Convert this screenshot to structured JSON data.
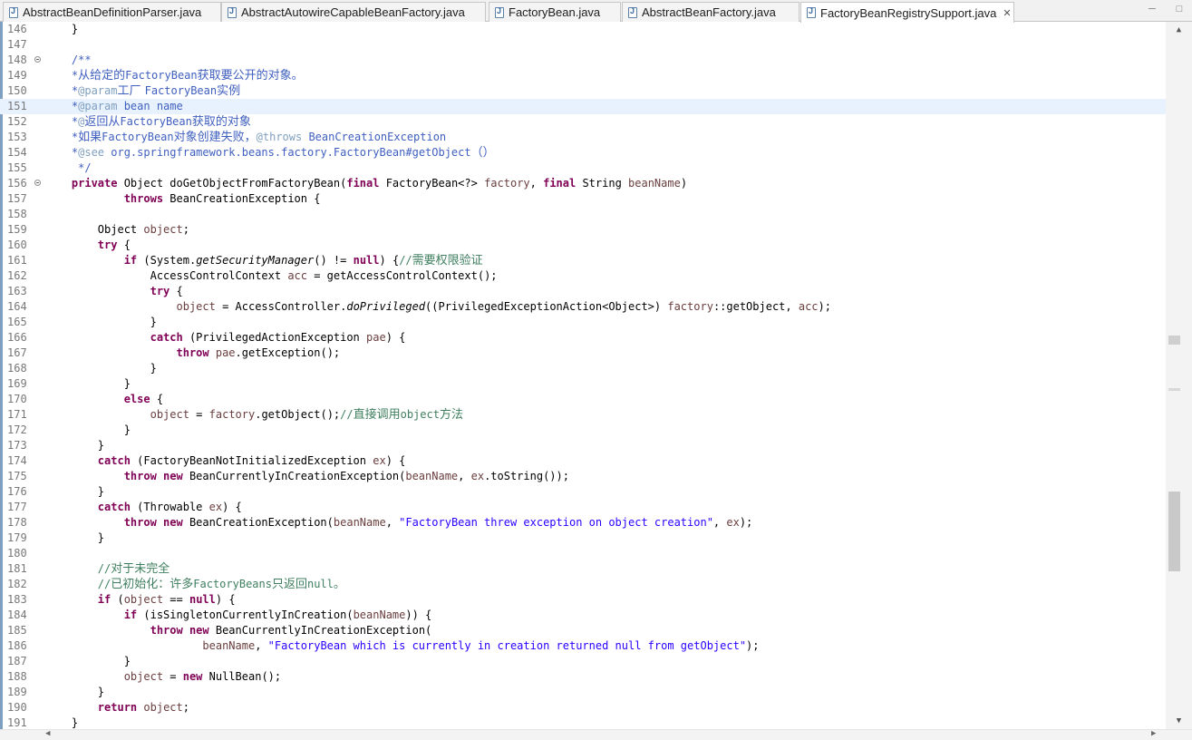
{
  "tabs": [
    {
      "label": "AbstractBeanDefinitionParser.java",
      "active": false
    },
    {
      "label": "AbstractAutowireCapableBeanFactory.java",
      "active": false
    },
    {
      "label": "FactoryBean.java",
      "active": false
    },
    {
      "label": "AbstractBeanFactory.java",
      "active": false
    },
    {
      "label": "FactoryBeanRegistrySupport.java",
      "active": true
    }
  ],
  "icons": {
    "tab": "java-file-icon",
    "close": "close-icon",
    "minimize": "minimize-icon",
    "maximize": "maximize-icon"
  },
  "current_line": 151,
  "folded_markers": [
    148,
    156
  ],
  "lines": [
    {
      "n": 146,
      "segs": [
        [
          "",
          "    }"
        ]
      ]
    },
    {
      "n": 147,
      "segs": []
    },
    {
      "n": 148,
      "segs": [
        [
          "jd",
          "    /**"
        ]
      ]
    },
    {
      "n": 149,
      "segs": [
        [
          "jd",
          "    *"
        ],
        [
          "jd cjk",
          "从给定的"
        ],
        [
          "jd",
          "FactoryBean"
        ],
        [
          "jd cjk",
          "获取要公开的对象。"
        ]
      ]
    },
    {
      "n": 150,
      "segs": [
        [
          "jd",
          "    *"
        ],
        [
          "jdt",
          "@param"
        ],
        [
          "jd cjk",
          "工厂 "
        ],
        [
          "jd",
          "FactoryBean"
        ],
        [
          "jd cjk",
          "实例"
        ]
      ]
    },
    {
      "n": 151,
      "segs": [
        [
          "jd",
          "    *"
        ],
        [
          "jdt",
          "@param"
        ],
        [
          "jd",
          " bean name"
        ]
      ]
    },
    {
      "n": 152,
      "segs": [
        [
          "jd",
          "    *"
        ],
        [
          "jdt",
          "@"
        ],
        [
          "jd cjk",
          "返回从"
        ],
        [
          "jd",
          "FactoryBean"
        ],
        [
          "jd cjk",
          "获取的对象"
        ]
      ]
    },
    {
      "n": 153,
      "segs": [
        [
          "jd",
          "    *"
        ],
        [
          "jd cjk",
          "如果"
        ],
        [
          "jd",
          "FactoryBean"
        ],
        [
          "jd cjk",
          "对象创建失败，"
        ],
        [
          "jdt",
          "@throws"
        ],
        [
          "jd",
          " BeanCreationException"
        ]
      ]
    },
    {
      "n": 154,
      "segs": [
        [
          "jd",
          "    *"
        ],
        [
          "jdt",
          "@see"
        ],
        [
          "jd",
          " org.springframework.beans.factory.FactoryBean#getObject"
        ],
        [
          "jd cjk",
          "（）"
        ]
      ]
    },
    {
      "n": 155,
      "segs": [
        [
          "jd",
          "     */"
        ]
      ]
    },
    {
      "n": 156,
      "segs": [
        [
          "kw",
          "    private"
        ],
        [
          "",
          " Object doGetObjectFromFactoryBean("
        ],
        [
          "kw",
          "final"
        ],
        [
          "",
          " FactoryBean<?> "
        ],
        [
          "fld",
          "factory"
        ],
        [
          "",
          ", "
        ],
        [
          "kw",
          "final"
        ],
        [
          "",
          " String "
        ],
        [
          "fld",
          "beanName"
        ],
        [
          "",
          ")"
        ]
      ]
    },
    {
      "n": 157,
      "segs": [
        [
          "",
          "            "
        ],
        [
          "kw",
          "throws"
        ],
        [
          "",
          " BeanCreationException {"
        ]
      ]
    },
    {
      "n": 158,
      "segs": []
    },
    {
      "n": 159,
      "segs": [
        [
          "",
          "        Object "
        ],
        [
          "fld",
          "object"
        ],
        [
          "",
          ";"
        ]
      ]
    },
    {
      "n": 160,
      "segs": [
        [
          "kw",
          "        try"
        ],
        [
          "",
          " {"
        ]
      ]
    },
    {
      "n": 161,
      "segs": [
        [
          "kw",
          "            if"
        ],
        [
          "",
          " (System."
        ],
        [
          "it",
          "getSecurityManager"
        ],
        [
          "",
          "() != "
        ],
        [
          "kw",
          "null"
        ],
        [
          "",
          ") {"
        ],
        [
          "cmt",
          "//"
        ],
        [
          "cmt cjk",
          "需要权限验证"
        ]
      ]
    },
    {
      "n": 162,
      "segs": [
        [
          "",
          "                AccessControlContext "
        ],
        [
          "fld",
          "acc"
        ],
        [
          "",
          " = getAccessControlContext();"
        ]
      ]
    },
    {
      "n": 163,
      "segs": [
        [
          "kw",
          "                try"
        ],
        [
          "",
          " {"
        ]
      ]
    },
    {
      "n": 164,
      "segs": [
        [
          "fld",
          "                    object"
        ],
        [
          "",
          " = AccessController."
        ],
        [
          "it",
          "doPrivileged"
        ],
        [
          "",
          "((PrivilegedExceptionAction<Object>) "
        ],
        [
          "fld",
          "factory"
        ],
        [
          "",
          "::getObject, "
        ],
        [
          "fld",
          "acc"
        ],
        [
          "",
          ");"
        ]
      ]
    },
    {
      "n": 165,
      "segs": [
        [
          "",
          "                }"
        ]
      ]
    },
    {
      "n": 166,
      "segs": [
        [
          "kw",
          "                catch"
        ],
        [
          "",
          " (PrivilegedActionException "
        ],
        [
          "fld",
          "pae"
        ],
        [
          "",
          ") {"
        ]
      ]
    },
    {
      "n": 167,
      "segs": [
        [
          "kw",
          "                    throw"
        ],
        [
          "",
          " "
        ],
        [
          "fld",
          "pae"
        ],
        [
          "",
          ".getException();"
        ]
      ]
    },
    {
      "n": 168,
      "segs": [
        [
          "",
          "                }"
        ]
      ]
    },
    {
      "n": 169,
      "segs": [
        [
          "",
          "            }"
        ]
      ]
    },
    {
      "n": 170,
      "segs": [
        [
          "kw",
          "            else"
        ],
        [
          "",
          " {"
        ]
      ]
    },
    {
      "n": 171,
      "segs": [
        [
          "fld",
          "                object"
        ],
        [
          "",
          " = "
        ],
        [
          "fld",
          "factory"
        ],
        [
          "",
          ".getObject();"
        ],
        [
          "cmt",
          "//"
        ],
        [
          "cmt cjk",
          "直接调用"
        ],
        [
          "cmt",
          "object"
        ],
        [
          "cmt cjk",
          "方法"
        ]
      ]
    },
    {
      "n": 172,
      "segs": [
        [
          "",
          "            }"
        ]
      ]
    },
    {
      "n": 173,
      "segs": [
        [
          "",
          "        }"
        ]
      ]
    },
    {
      "n": 174,
      "segs": [
        [
          "kw",
          "        catch"
        ],
        [
          "",
          " (FactoryBeanNotInitializedException "
        ],
        [
          "fld",
          "ex"
        ],
        [
          "",
          ") {"
        ]
      ]
    },
    {
      "n": 175,
      "segs": [
        [
          "kw",
          "            throw new"
        ],
        [
          "",
          " BeanCurrentlyInCreationException("
        ],
        [
          "fld",
          "beanName"
        ],
        [
          "",
          ", "
        ],
        [
          "fld",
          "ex"
        ],
        [
          "",
          ".toString());"
        ]
      ]
    },
    {
      "n": 176,
      "segs": [
        [
          "",
          "        }"
        ]
      ]
    },
    {
      "n": 177,
      "segs": [
        [
          "kw",
          "        catch"
        ],
        [
          "",
          " (Throwable "
        ],
        [
          "fld",
          "ex"
        ],
        [
          "",
          ") {"
        ]
      ]
    },
    {
      "n": 178,
      "segs": [
        [
          "kw",
          "            throw new"
        ],
        [
          "",
          " BeanCreationException("
        ],
        [
          "fld",
          "beanName"
        ],
        [
          "",
          ", "
        ],
        [
          "str",
          "\"FactoryBean threw exception on object creation\""
        ],
        [
          "",
          ", "
        ],
        [
          "fld",
          "ex"
        ],
        [
          "",
          ");"
        ]
      ]
    },
    {
      "n": 179,
      "segs": [
        [
          "",
          "        }"
        ]
      ]
    },
    {
      "n": 180,
      "segs": []
    },
    {
      "n": 181,
      "segs": [
        [
          "cmt",
          "        //"
        ],
        [
          "cmt cjk",
          "对于未完全"
        ]
      ]
    },
    {
      "n": 182,
      "segs": [
        [
          "cmt",
          "        //"
        ],
        [
          "cmt cjk",
          "已初始化：许多"
        ],
        [
          "cmt",
          "FactoryBeans"
        ],
        [
          "cmt cjk",
          "只返回"
        ],
        [
          "cmt",
          "null"
        ],
        [
          "cmt cjk",
          "。"
        ]
      ]
    },
    {
      "n": 183,
      "segs": [
        [
          "kw",
          "        if"
        ],
        [
          "",
          " ("
        ],
        [
          "fld",
          "object"
        ],
        [
          "",
          " == "
        ],
        [
          "kw",
          "null"
        ],
        [
          "",
          ") {"
        ]
      ]
    },
    {
      "n": 184,
      "segs": [
        [
          "kw",
          "            if"
        ],
        [
          "",
          " (isSingletonCurrentlyInCreation("
        ],
        [
          "fld",
          "beanName"
        ],
        [
          "",
          ")) {"
        ]
      ]
    },
    {
      "n": 185,
      "segs": [
        [
          "kw",
          "                throw new"
        ],
        [
          "",
          " BeanCurrentlyInCreationException("
        ]
      ]
    },
    {
      "n": 186,
      "segs": [
        [
          "fld",
          "                        beanName"
        ],
        [
          "",
          ", "
        ],
        [
          "str",
          "\"FactoryBean which is currently in creation returned null from getObject\""
        ],
        [
          "",
          ");"
        ]
      ]
    },
    {
      "n": 187,
      "segs": [
        [
          "",
          "            }"
        ]
      ]
    },
    {
      "n": 188,
      "segs": [
        [
          "fld",
          "            object"
        ],
        [
          "",
          " = "
        ],
        [
          "kw",
          "new"
        ],
        [
          "",
          " NullBean();"
        ]
      ]
    },
    {
      "n": 189,
      "segs": [
        [
          "",
          "        }"
        ]
      ]
    },
    {
      "n": 190,
      "segs": [
        [
          "kw",
          "        return"
        ],
        [
          "",
          " "
        ],
        [
          "fld",
          "object"
        ],
        [
          "",
          ";"
        ]
      ]
    },
    {
      "n": 191,
      "segs": [
        [
          "",
          "    }"
        ]
      ]
    }
  ]
}
